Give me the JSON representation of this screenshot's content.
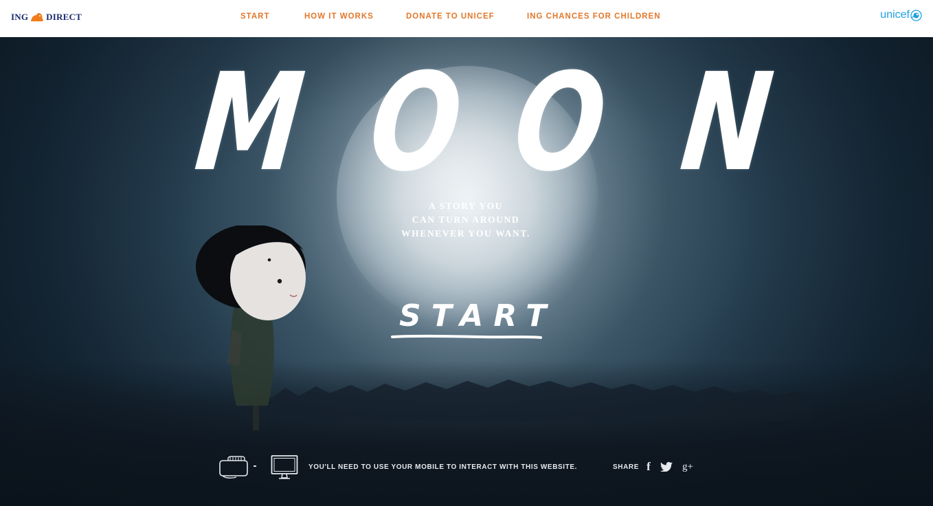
{
  "header": {
    "brand_left": {
      "part1": "ING",
      "part2": "DIRECT",
      "icon": "lion-icon"
    },
    "nav": [
      {
        "label": "START"
      },
      {
        "label": "HOW IT WORKS"
      },
      {
        "label": "DONATE TO UNICEF"
      },
      {
        "label": "ING CHANCES FOR CHILDREN"
      }
    ],
    "brand_right": {
      "text": "unicef",
      "icon": "unicef-emblem-icon"
    }
  },
  "hero": {
    "title_letters": [
      "M",
      "O",
      "O",
      "N"
    ],
    "tagline_lines": [
      "A STORY YOU",
      "CAN TURN AROUND",
      "WHENEVER YOU WANT."
    ],
    "start_label": "START"
  },
  "footer": {
    "notice": "YOU'LL NEED TO USE YOUR MOBILE TO INTERACT WITH THIS WEBSITE.",
    "share_label": "SHARE",
    "social_icons": [
      "facebook-icon",
      "twitter-icon",
      "google-plus-icon"
    ],
    "facebook_glyph": "f",
    "googleplus_glyph": "g+"
  },
  "colors": {
    "nav_accent": "#e1772a",
    "ing_navy": "#1a2a6c",
    "unicef_blue": "#1ca0e0",
    "text_light": "#ffffff"
  }
}
